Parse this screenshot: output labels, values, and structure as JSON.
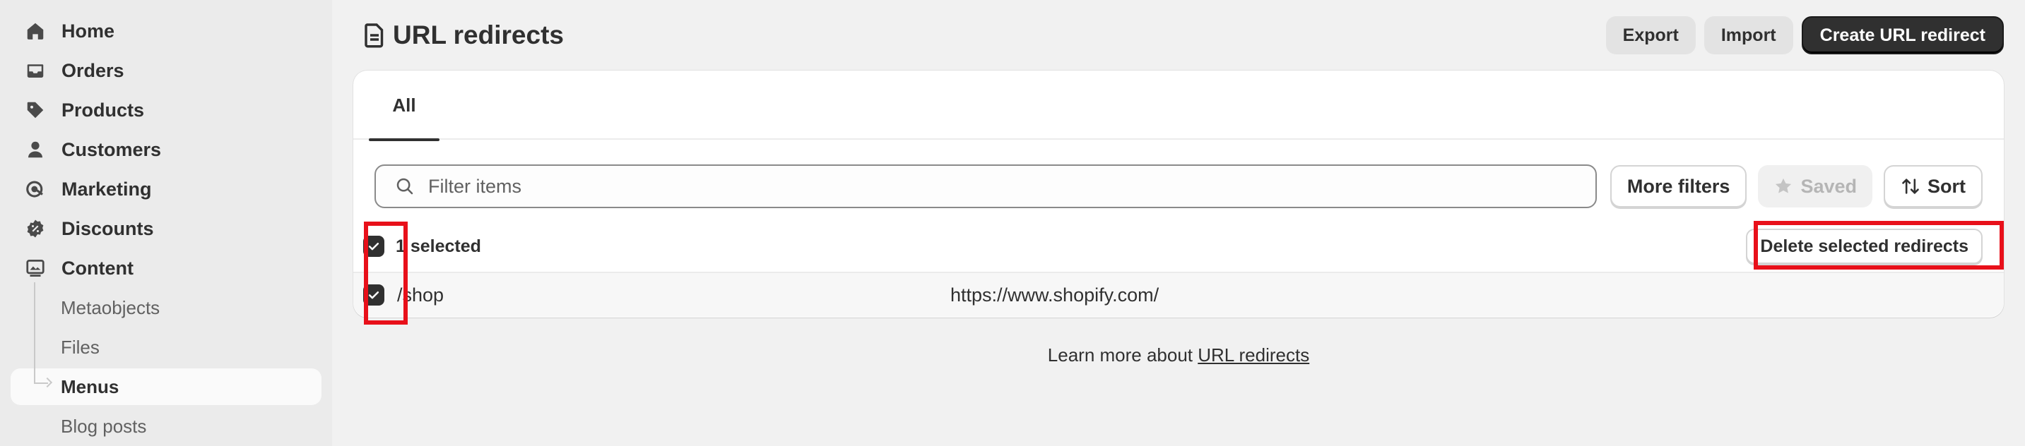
{
  "sidebar": {
    "items": [
      {
        "label": "Home",
        "icon": "home-icon"
      },
      {
        "label": "Orders",
        "icon": "inbox-icon"
      },
      {
        "label": "Products",
        "icon": "tag-icon"
      },
      {
        "label": "Customers",
        "icon": "person-icon"
      },
      {
        "label": "Marketing",
        "icon": "target-icon"
      },
      {
        "label": "Discounts",
        "icon": "discount-icon"
      },
      {
        "label": "Content",
        "icon": "image-icon"
      }
    ],
    "subitems": [
      {
        "label": "Metaobjects"
      },
      {
        "label": "Files"
      },
      {
        "label": "Menus",
        "active": true
      },
      {
        "label": "Blog posts"
      }
    ]
  },
  "header": {
    "title": "URL redirects",
    "export_label": "Export",
    "import_label": "Import",
    "create_label": "Create URL redirect"
  },
  "tabs": [
    {
      "label": "All"
    }
  ],
  "filters": {
    "search_placeholder": "Filter items",
    "more_filters_label": "More filters",
    "saved_label": "Saved",
    "sort_label": "Sort"
  },
  "bulk": {
    "selected_text": "1 selected",
    "delete_label": "Delete selected redirects"
  },
  "rows": [
    {
      "from": "/shop",
      "to": "https://www.shopify.com/",
      "checked": true
    }
  ],
  "footer": {
    "prefix": "Learn more about ",
    "link": "URL redirects"
  },
  "colors": {
    "background": "#f1f1f1",
    "sidebar": "#ebebeb",
    "primary_button": "#303030",
    "highlight": "#e8101a"
  }
}
